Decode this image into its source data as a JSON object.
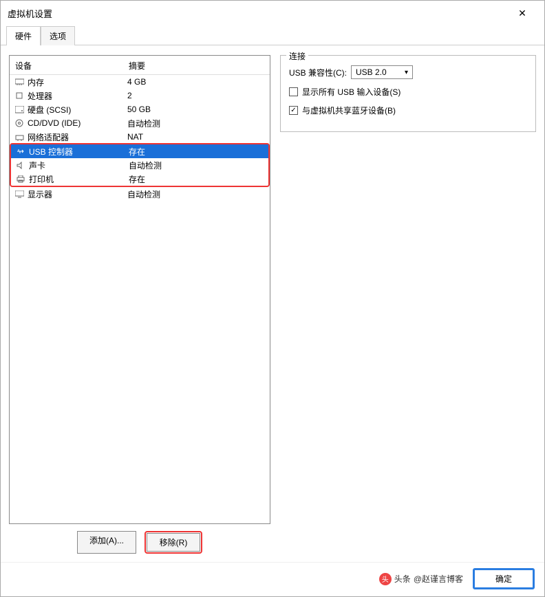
{
  "window": {
    "title": "虚拟机设置"
  },
  "tabs": {
    "hardware": "硬件",
    "options": "选项",
    "active": "hardware"
  },
  "hw_header": {
    "device": "设备",
    "summary": "摘要"
  },
  "hardware": {
    "memory": {
      "label": "内存",
      "summary": "4 GB"
    },
    "cpu": {
      "label": "处理器",
      "summary": "2"
    },
    "disk": {
      "label": "硬盘 (SCSI)",
      "summary": "50 GB"
    },
    "cddvd": {
      "label": "CD/DVD (IDE)",
      "summary": "自动检测"
    },
    "network": {
      "label": "网络适配器",
      "summary": "NAT"
    },
    "usb": {
      "label": "USB 控制器",
      "summary": "存在"
    },
    "sound": {
      "label": "声卡",
      "summary": "自动检测"
    },
    "printer": {
      "label": "打印机",
      "summary": "存在"
    },
    "display": {
      "label": "显示器",
      "summary": "自动检测"
    }
  },
  "buttons": {
    "add": "添加(A)...",
    "remove": "移除(R)",
    "ok": "确定"
  },
  "connection": {
    "legend": "连接",
    "compat_label": "USB 兼容性(C):",
    "compat_value": "USB 2.0",
    "show_all": "显示所有 USB 输入设备(S)",
    "share_bt": "与虚拟机共享蓝牙设备(B)"
  },
  "attribution": {
    "prefix": "头条",
    "handle": "@赵谨言博客"
  }
}
